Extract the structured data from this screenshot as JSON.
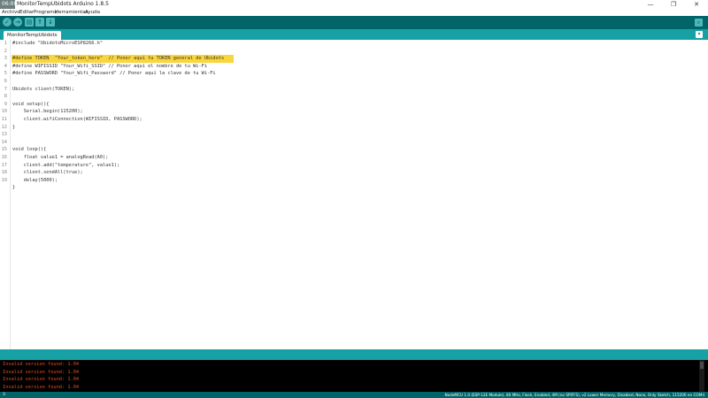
{
  "window": {
    "time_badge": "06:00",
    "title": "MonitorTempUbidots Arduino 1.8.5",
    "minimize": "—",
    "maximize": "❐",
    "close": "✕"
  },
  "menu": [
    "Archivo",
    "Editar",
    "Programa",
    "Herramientas",
    "Ayuda"
  ],
  "toolbar": {
    "verify_icon": "✓",
    "upload_icon": "→",
    "new_icon": "▤",
    "open_icon": "↑",
    "save_icon": "↓",
    "serial_icon": "⌕"
  },
  "tab": {
    "label": "MonitorTempUbidots",
    "menu_icon": "▾"
  },
  "editor": {
    "line_numbers": [
      "1",
      "2",
      "3",
      "4",
      "5",
      "6",
      "7",
      "8",
      "9",
      "10",
      "11",
      "12",
      "13",
      "14",
      "15",
      "16",
      "17",
      "18",
      "19"
    ],
    "highlighted_line": 3,
    "lines": [
      "#include \"UbidotsMicroESP8266.h\"",
      "",
      "#define TOKEN  \"Your_token_here\"  // Poner aquí tu TOKEN general de Ubidots",
      "#define WIFISSID \"Your_Wifi_SSID\" // Poner aquí el nombre de tu Wi-Fi",
      "#define PASSWORD \"Your_Wifi_Password\" // Poner aquí la clave de tu Wi-Fi",
      "",
      "Ubidots client(TOKEN);",
      "",
      "void setup(){",
      "    Serial.begin(115200);",
      "    client.wifiConnection(WIFISSID, PASSWORD);",
      "}",
      "",
      "",
      "void loop(){",
      "    float value1 = analogRead(A0);",
      "    client.add(\"temperature\", value1);",
      "    client.sendAll(true);",
      "    delay(5000);",
      "}"
    ]
  },
  "console": {
    "messages": [
      "Invalid version found: 1.04",
      "Invalid version found: 1.04",
      "Invalid version found: 1.04",
      "Invalid version found: 1.04"
    ]
  },
  "status": {
    "line": "3",
    "board": "NodeMCU 1.0 (ESP-12E Module), 80 MHz, Flash, Enabled, 4M (no SPIFFS), v2 Lower Memory, Disabled, None, Only Sketch, 115200 en COM4"
  }
}
